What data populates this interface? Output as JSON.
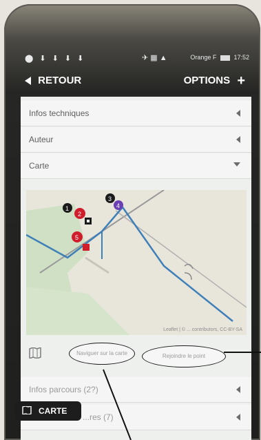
{
  "status_bar": {
    "left_icons": "⬤ ⬇ ⬇ ⬇ ⬇",
    "mid_icons": "✈ ▦ ▲",
    "carrier": "Orange F",
    "battery_icon": "battery-icon",
    "time": "17:52"
  },
  "action_bar": {
    "back_label": "RETOUR",
    "options_label": "OPTIONS",
    "plus_symbol": "+"
  },
  "sections": {
    "infos_techniques": "Infos techniques",
    "auteur": "Auteur",
    "carte": "Carte",
    "infos_parcours": "Infos parcours (2?)",
    "last_row": "...res (7)"
  },
  "map": {
    "attribution": "Leaflet | © ... contributors, CC-BY-SA"
  },
  "buttons": {
    "navigate": "Naviguer sur la carte",
    "reach": "Rejoindre le point"
  },
  "carte_pill": {
    "label": "CARTE"
  },
  "markers": [
    {
      "label": "1",
      "color": "#1a1a1a"
    },
    {
      "label": "2",
      "color": "#d01d2c"
    },
    {
      "label": "3",
      "color": "#1a1a1a"
    },
    {
      "label": "4",
      "color": "#6a3fb3"
    },
    {
      "label": "5",
      "color": "#d01d2c"
    }
  ],
  "colors": {
    "route_blue": "#3f7fb8",
    "road_gray": "#9a9a9a",
    "green_area": "#cfe0c4",
    "map_bg": "#e8e6db"
  }
}
